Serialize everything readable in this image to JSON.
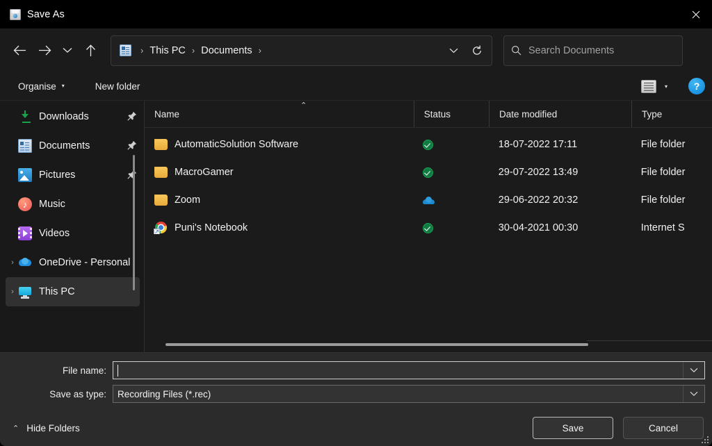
{
  "window": {
    "title": "Save As",
    "icon": "save-disk-icon",
    "close_label": "✕"
  },
  "nav": {
    "back_icon": "arrow-left-icon",
    "forward_icon": "arrow-right-icon",
    "recent_icon": "chevron-down-icon",
    "up_icon": "arrow-up-icon",
    "breadcrumb": {
      "folder_icon": "documents-icon",
      "items": [
        "This PC",
        "Documents"
      ],
      "separator": "›",
      "trailing_separator": "›",
      "dropdown_icon": "chevron-down-icon",
      "refresh_icon": "refresh-icon"
    },
    "search": {
      "placeholder": "Search Documents",
      "value": "",
      "icon": "search-icon"
    }
  },
  "commandbar": {
    "organise_label": "Organise",
    "organise_caret": "▾",
    "new_folder_label": "New folder",
    "view_icon": "list-view-icon",
    "view_caret": "▾",
    "help_label": "?"
  },
  "sidebar": {
    "items": [
      {
        "label": "Downloads",
        "icon": "downloads-icon",
        "pinned": true,
        "expandable": false,
        "selected": false
      },
      {
        "label": "Documents",
        "icon": "documents-icon",
        "pinned": true,
        "expandable": false,
        "selected": false
      },
      {
        "label": "Pictures",
        "icon": "pictures-icon",
        "pinned": true,
        "expandable": false,
        "selected": false
      },
      {
        "label": "Music",
        "icon": "music-icon",
        "pinned": false,
        "expandable": false,
        "selected": false
      },
      {
        "label": "Videos",
        "icon": "videos-icon",
        "pinned": false,
        "expandable": false,
        "selected": false
      },
      {
        "label": "OneDrive - Personal",
        "icon": "onedrive-icon",
        "pinned": false,
        "expandable": true,
        "selected": false
      },
      {
        "label": "This PC",
        "icon": "this-pc-icon",
        "pinned": false,
        "expandable": true,
        "selected": true
      }
    ],
    "expander_glyph": "›"
  },
  "filelist": {
    "columns": [
      {
        "key": "name",
        "label": "Name",
        "sorted": "asc",
        "sort_glyph": "⌃"
      },
      {
        "key": "status",
        "label": "Status"
      },
      {
        "key": "date",
        "label": "Date modified"
      },
      {
        "key": "type",
        "label": "Type"
      }
    ],
    "rows": [
      {
        "name": "AutomaticSolution Software",
        "icon": "folder-icon",
        "status": "synced-check-icon",
        "date": "18-07-2022 17:11",
        "type": "File folder"
      },
      {
        "name": "MacroGamer",
        "icon": "folder-icon",
        "status": "synced-check-icon",
        "date": "29-07-2022 13:49",
        "type": "File folder"
      },
      {
        "name": "Zoom",
        "icon": "folder-icon",
        "status": "cloud-icon",
        "date": "29-06-2022 20:32",
        "type": "File folder"
      },
      {
        "name": "Puni's Notebook",
        "icon": "chrome-shortcut-icon",
        "status": "synced-check-icon",
        "date": "30-04-2021 00:30",
        "type": "Internet S"
      }
    ]
  },
  "form": {
    "file_name_label": "File name:",
    "file_name_value": "",
    "save_as_type_label": "Save as type:",
    "save_as_type_value": "Recording Files (*.rec)",
    "dropdown_icon": "chevron-down-icon"
  },
  "footer": {
    "hide_folders_label": "Hide Folders",
    "hide_folders_glyph": "⌃",
    "save_label": "Save",
    "cancel_label": "Cancel",
    "resize_grip": "resize-grip-icon"
  },
  "colors": {
    "window_background": "#1b1b1b",
    "titlebar_background": "#000000",
    "form_background": "#2b2b2b",
    "accent_help": "#0a84d8",
    "status_synced": "#107c41",
    "status_cloud": "#1b8ad1",
    "folder": "#e9a93a",
    "selection": "#313131"
  }
}
